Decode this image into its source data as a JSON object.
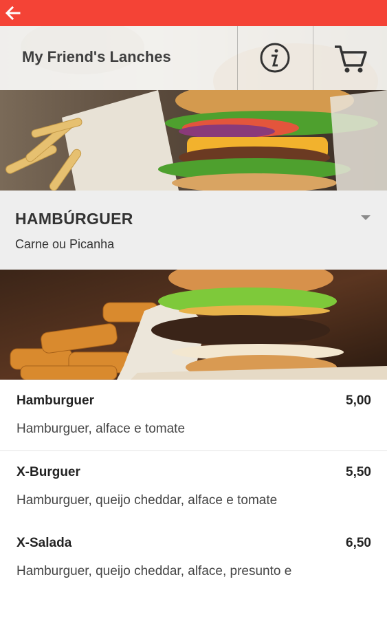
{
  "app": {
    "title": "My Friend's Lanches",
    "accent_color": "#f44336",
    "back_icon": "arrow-left-icon",
    "info_icon": "info-icon",
    "cart_icon": "cart-icon"
  },
  "category": {
    "title": "HAMBÚRGUER",
    "subtitle": "Carne ou Picanha",
    "expand_icon": "caret-down-icon"
  },
  "items": [
    {
      "name": "Hamburguer",
      "price": "5,00",
      "description": "Hamburguer, alface e tomate"
    },
    {
      "name": "X-Burguer",
      "price": "5,50",
      "description": "Hamburguer, queijo cheddar, alface e tomate"
    },
    {
      "name": "X-Salada",
      "price": "6,50",
      "description": "Hamburguer, queijo cheddar, alface, presunto e"
    }
  ]
}
